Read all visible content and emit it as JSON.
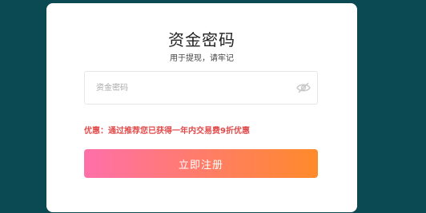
{
  "dialog": {
    "title": "资金密码",
    "subtitle": "用于提现，请牢记",
    "password_field": {
      "placeholder": "资金密码",
      "value": ""
    },
    "eye_icon": "eye-off-icon",
    "promo_text": "优惠：通过推荐您已获得一年内交易费9折优惠",
    "submit_label": "立即注册"
  },
  "colors": {
    "background": "#0b4a52",
    "promo": "#e14b4b",
    "button_gradient_start": "#ff6fa9",
    "button_gradient_end": "#ff8a2a"
  }
}
